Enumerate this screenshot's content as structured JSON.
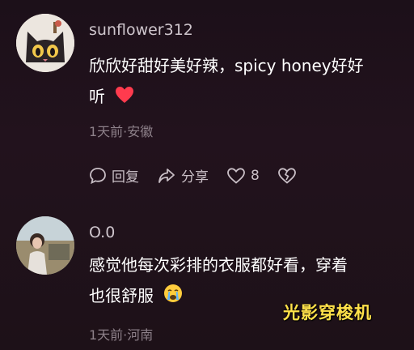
{
  "comments": [
    {
      "username": "sunflower312",
      "line1": "欣欣好甜好美好辣，spicy honey好好",
      "line2": "听",
      "emoji": "❤️",
      "meta": "1天前·安徽",
      "reply_label": "回复",
      "share_label": "分享",
      "like_count": "8"
    },
    {
      "username": "O.0",
      "line1": "感觉他每次彩排的衣服都好看，穿着",
      "line2": "也很舒服",
      "emoji": "😭",
      "meta": "1天前·河南"
    }
  ],
  "watermark": "光影穿梭机",
  "colors": {
    "background": "#1e1119",
    "username": "#cfc6cd",
    "meta": "#8d8089",
    "heart": "#ff3b4e",
    "watermark": "#ffe14a"
  }
}
